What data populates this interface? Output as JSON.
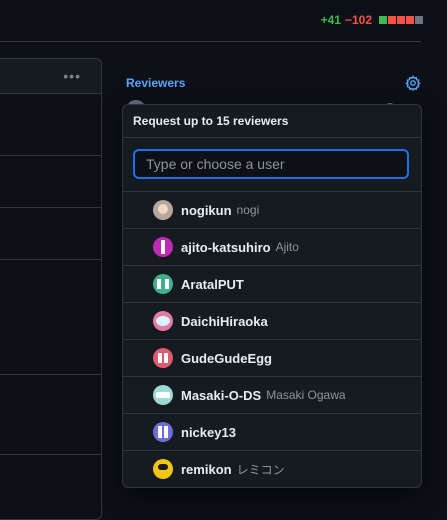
{
  "diffstat": {
    "additions": "+41",
    "deletions": "−102",
    "blocks": [
      "#3fb950",
      "#f85149",
      "#f85149",
      "#f85149",
      "#6e7681"
    ]
  },
  "left_panel": {
    "menu_glyph": "•••"
  },
  "sidebar": {
    "reviewers_title": "Reviewers",
    "settings_icon": "gear-icon"
  },
  "popover": {
    "header": "Request up to 15 reviewers",
    "filter_placeholder": "Type or choose a user",
    "users": [
      {
        "login": "nogikun",
        "name": "nogi",
        "avatar": "av-nogi"
      },
      {
        "login": "ajito-katsuhiro",
        "name": "Ajito",
        "avatar": "av-ajito"
      },
      {
        "login": "AratalPUT",
        "name": "",
        "avatar": "av-aratal"
      },
      {
        "login": "DaichiHiraoka",
        "name": "",
        "avatar": "av-daichi"
      },
      {
        "login": "GudeGudeEgg",
        "name": "",
        "avatar": "av-gude"
      },
      {
        "login": "Masaki-O-DS",
        "name": "Masaki Ogawa",
        "avatar": "av-masaki"
      },
      {
        "login": "nickey13",
        "name": "",
        "avatar": "av-nickey"
      },
      {
        "login": "remikon",
        "name": "レミコン",
        "avatar": "av-remi"
      }
    ]
  }
}
